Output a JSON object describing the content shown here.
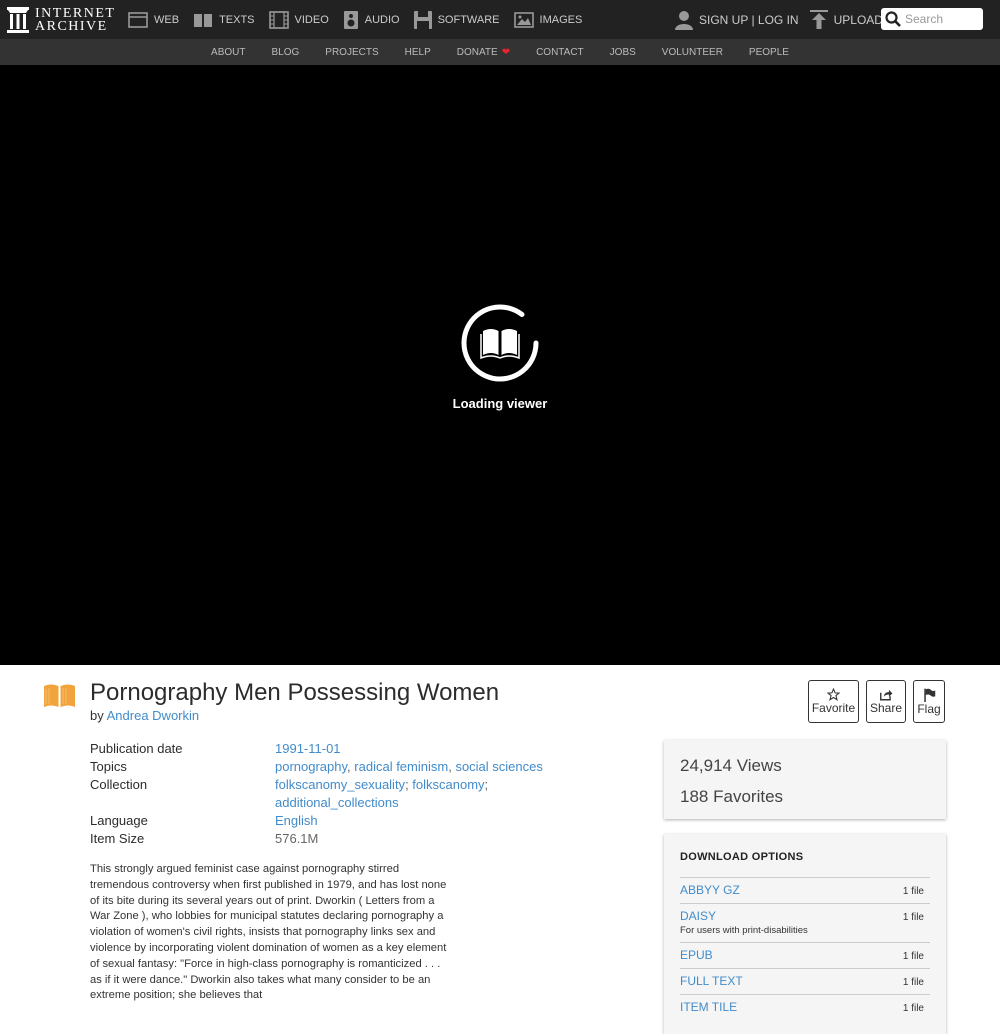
{
  "nav": {
    "logo_line1": "INTERNET",
    "logo_line2": "ARCHIVE",
    "media": [
      {
        "label": "WEB",
        "icon": "web-icon"
      },
      {
        "label": "TEXTS",
        "icon": "texts-icon"
      },
      {
        "label": "VIDEO",
        "icon": "video-icon"
      },
      {
        "label": "AUDIO",
        "icon": "audio-icon"
      },
      {
        "label": "SOFTWARE",
        "icon": "software-icon"
      },
      {
        "label": "IMAGES",
        "icon": "images-icon"
      }
    ],
    "signup_login": "SIGN UP | LOG IN",
    "upload": "UPLOAD",
    "search_placeholder": "Search"
  },
  "subnav": [
    "ABOUT",
    "BLOG",
    "PROJECTS",
    "HELP",
    "DONATE",
    "CONTACT",
    "JOBS",
    "VOLUNTEER",
    "PEOPLE"
  ],
  "viewer": {
    "loading_text": "Loading viewer"
  },
  "item": {
    "title": "Pornography Men Possessing Women",
    "by_prefix": "by",
    "author": "Andrea Dworkin",
    "actions": {
      "favorite": "Favorite",
      "share": "Share",
      "flag": "Flag"
    },
    "metadata": {
      "pubdate_label": "Publication date",
      "pubdate": "1991-11-01",
      "topics_label": "Topics",
      "topics": [
        "pornography",
        "radical feminism",
        "social sciences"
      ],
      "collection_label": "Collection",
      "collections": [
        "folkscanomy_sexuality",
        "folkscanomy",
        "additional_collections"
      ],
      "language_label": "Language",
      "language": "English",
      "size_label": "Item Size",
      "size": "576.1M"
    },
    "description": "This strongly argued feminist case against pornography stirred tremendous controversy when first published in 1979, and has lost none of its bite during its several years out of print. Dworkin ( Letters from a War Zone ), who lobbies for municipal statutes declaring pornography a violation of women's civil rights, insists that pornography links sex and violence by incorporating violent domination of women as a key element of sexual fantasy: \"Force in high-class pornography is romanticized . . . as if it were dance.\" Dworkin also takes what many consider to be an extreme position; she believes that"
  },
  "stats": {
    "views_count": "24,914",
    "views_label": "Views",
    "favorites_count": "188",
    "favorites_label": "Favorites"
  },
  "downloads": {
    "heading": "DOWNLOAD OPTIONS",
    "rows": [
      {
        "name": "ABBYY GZ",
        "count": "1 file",
        "sub": ""
      },
      {
        "name": "DAISY",
        "count": "1 file",
        "sub": "For users with print-disabilities"
      },
      {
        "name": "EPUB",
        "count": "1 file",
        "sub": ""
      },
      {
        "name": "FULL TEXT",
        "count": "1 file",
        "sub": ""
      },
      {
        "name": "ITEM TILE",
        "count": "1 file",
        "sub": ""
      }
    ]
  },
  "colors": {
    "nav_bg": "#222222",
    "subnav_bg": "#333333",
    "link": "#428bca",
    "heart": "#e8242e",
    "texts_orange": "#f1a43b"
  }
}
